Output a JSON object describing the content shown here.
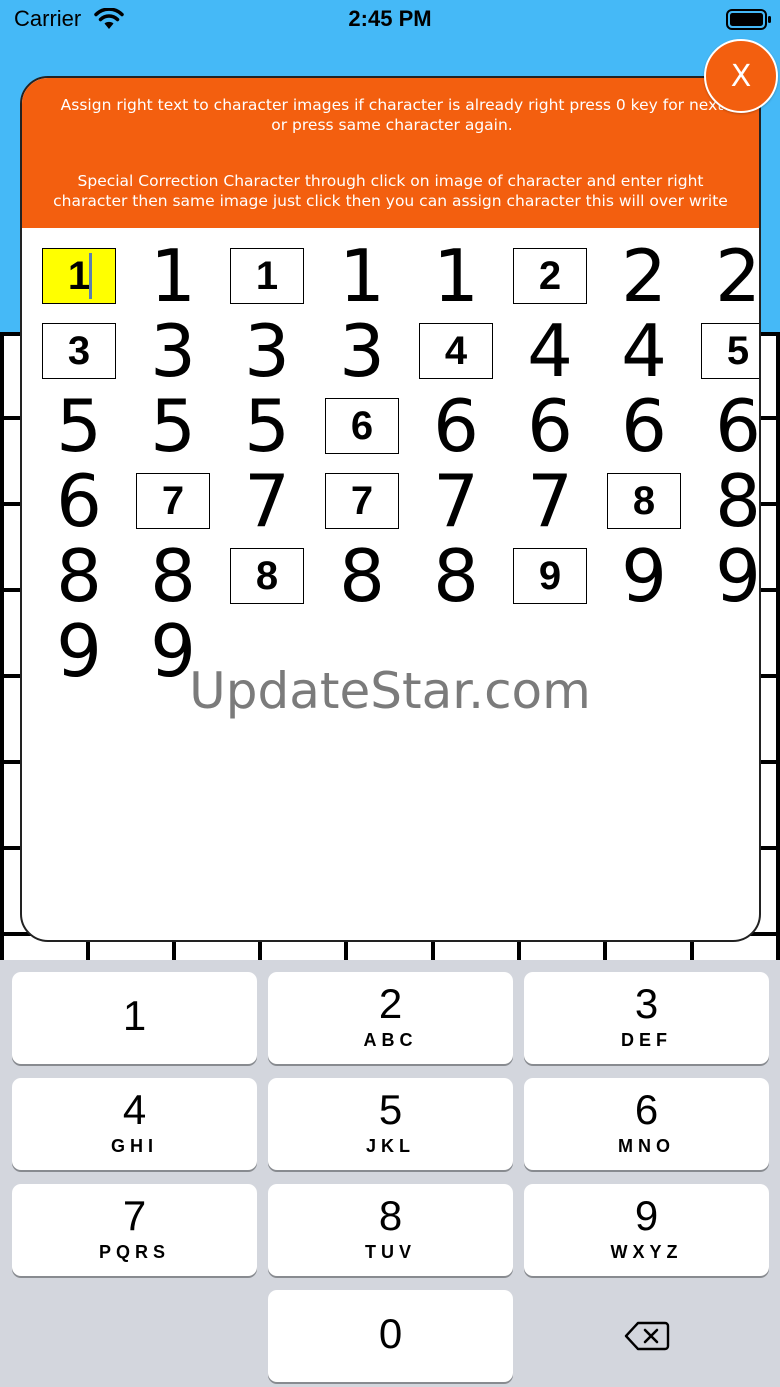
{
  "status_bar": {
    "carrier": "Carrier",
    "time": "2:45 PM"
  },
  "dialog": {
    "instruction_1": "Assign right text to character images if character is already right press 0 key for next\nor press same character again.",
    "instruction_2": "Special Correction Character through click on image of character and enter right\ncharacter then same image just click then you can assign character this will over write",
    "close_label": "X"
  },
  "character_rows": [
    [
      {
        "char": "1",
        "boxed": true,
        "selected": true
      },
      {
        "char": "1",
        "boxed": false
      },
      {
        "char": "1",
        "boxed": true
      },
      {
        "char": "1",
        "boxed": false
      },
      {
        "char": "1",
        "boxed": false
      },
      {
        "char": "2",
        "boxed": true
      },
      {
        "char": "2",
        "boxed": false
      },
      {
        "char": "2",
        "boxed": false
      }
    ],
    [
      {
        "char": "3",
        "boxed": true
      },
      {
        "char": "3",
        "boxed": false
      },
      {
        "char": "3",
        "boxed": false
      },
      {
        "char": "3",
        "boxed": false
      },
      {
        "char": "4",
        "boxed": true
      },
      {
        "char": "4",
        "boxed": false
      },
      {
        "char": "4",
        "boxed": false
      },
      {
        "char": "5",
        "boxed": true
      }
    ],
    [
      {
        "char": "5",
        "boxed": false
      },
      {
        "char": "5",
        "boxed": false
      },
      {
        "char": "5",
        "boxed": false
      },
      {
        "char": "6",
        "boxed": true
      },
      {
        "char": "6",
        "boxed": false
      },
      {
        "char": "6",
        "boxed": false
      },
      {
        "char": "6",
        "boxed": false
      },
      {
        "char": "6",
        "boxed": false
      }
    ],
    [
      {
        "char": "6",
        "boxed": false
      },
      {
        "char": "7",
        "boxed": true
      },
      {
        "char": "7",
        "boxed": false
      },
      {
        "char": "7",
        "boxed": true
      },
      {
        "char": "7",
        "boxed": false
      },
      {
        "char": "7",
        "boxed": false
      },
      {
        "char": "8",
        "boxed": true
      },
      {
        "char": "8",
        "boxed": false
      }
    ],
    [
      {
        "char": "8",
        "boxed": false
      },
      {
        "char": "8",
        "boxed": false
      },
      {
        "char": "8",
        "boxed": true
      },
      {
        "char": "8",
        "boxed": false
      },
      {
        "char": "8",
        "boxed": false
      },
      {
        "char": "9",
        "boxed": true
      },
      {
        "char": "9",
        "boxed": false
      },
      {
        "char": "9",
        "boxed": false
      }
    ],
    [
      {
        "char": "9",
        "boxed": false
      },
      {
        "char": "9",
        "boxed": false
      }
    ]
  ],
  "watermark": "UpdateStar.com",
  "keypad": {
    "keys": [
      {
        "digit": "1",
        "letters": ""
      },
      {
        "digit": "2",
        "letters": "ABC"
      },
      {
        "digit": "3",
        "letters": "DEF"
      },
      {
        "digit": "4",
        "letters": "GHI"
      },
      {
        "digit": "5",
        "letters": "JKL"
      },
      {
        "digit": "6",
        "letters": "MNO"
      },
      {
        "digit": "7",
        "letters": "PQRS"
      },
      {
        "digit": "8",
        "letters": "TUV"
      },
      {
        "digit": "9",
        "letters": "WXYZ"
      },
      {
        "digit": "0",
        "letters": ""
      }
    ],
    "delete_icon": "delete-backspace-icon"
  },
  "colors": {
    "header_blue": "#45b9f7",
    "accent_orange": "#f35f0f",
    "selection_yellow": "#ffff00",
    "keypad_bg": "#d3d6dd"
  }
}
